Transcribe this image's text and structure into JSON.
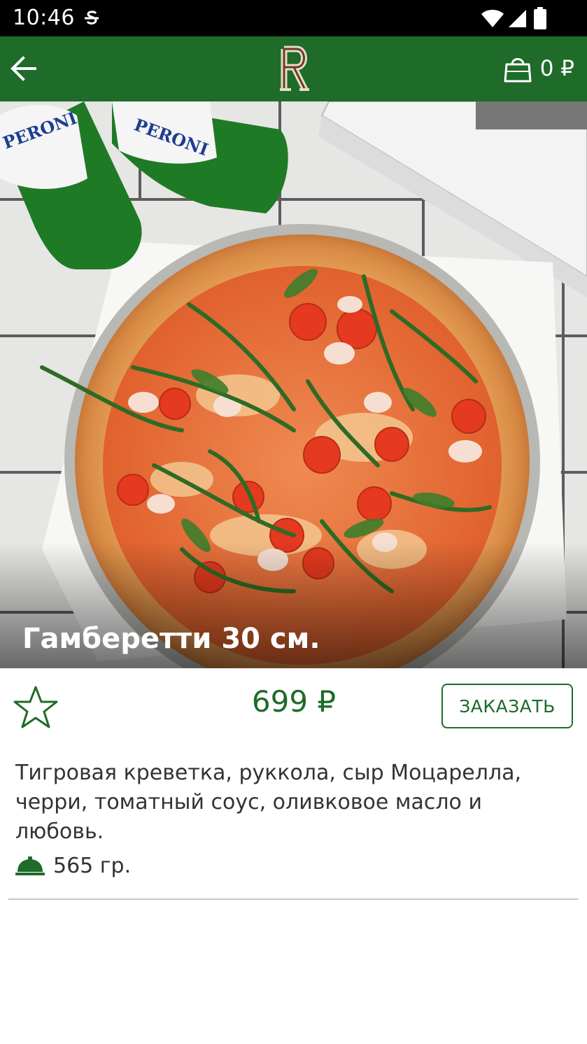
{
  "status_bar": {
    "time": "10:46"
  },
  "app_bar": {
    "cart_total": "0 ₽"
  },
  "product": {
    "title": "Гамберетти 30 см.",
    "price": "699 ₽",
    "order_label": "ЗАКАЗАТЬ",
    "description": "Тигровая креветка, руккола, сыр Моцарелла, черри, томатный соус, оливковое масло и любовь.",
    "weight": "565 гр."
  },
  "colors": {
    "brand_green": "#1e6b2a",
    "status_bar": "#000000"
  },
  "icons": [
    "back-arrow-icon",
    "logo-r-icon",
    "shopping-bag-icon",
    "star-outline-icon",
    "cloche-icon",
    "wifi-icon",
    "signal-icon",
    "battery-icon"
  ]
}
